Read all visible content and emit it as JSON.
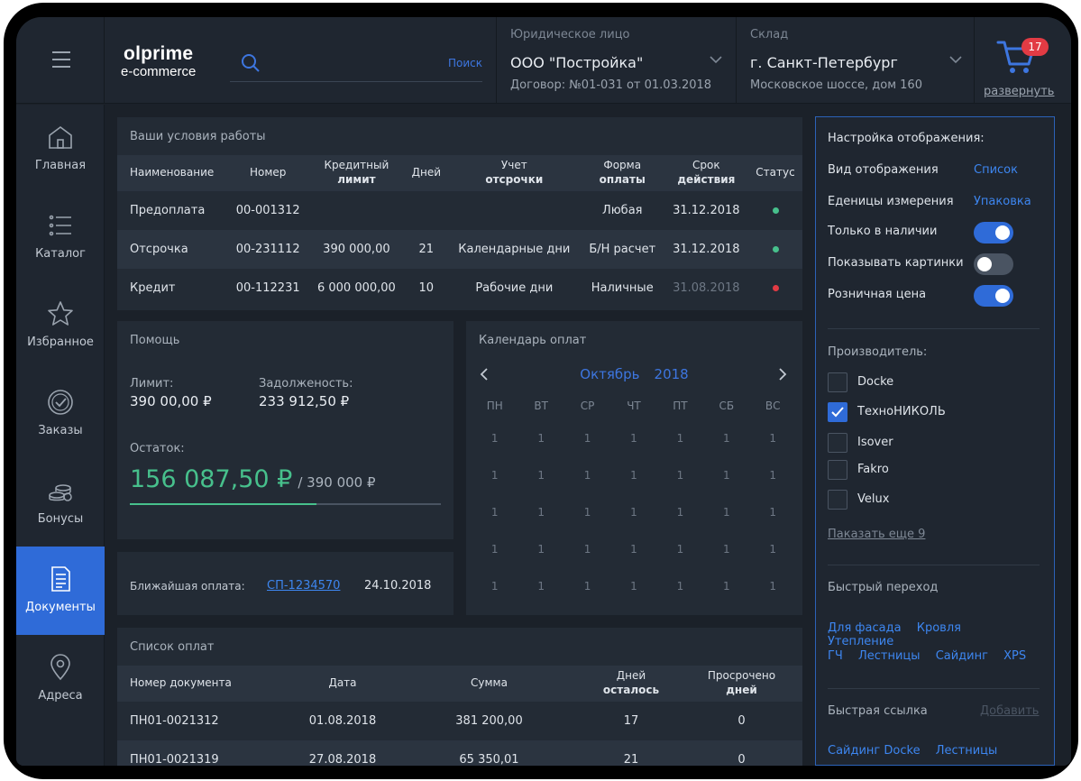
{
  "header": {
    "logo_main": "olprime",
    "logo_sub": "e-commerce",
    "search": {
      "placeholder": "",
      "button": "Поиск"
    },
    "legal": {
      "label": "Юридическое лицо",
      "value": "ООО \"Постройка\"",
      "sub": "Договор: №01-031 от 01.03.2018"
    },
    "store": {
      "label": "Склад",
      "value": "г. Санкт-Петербург",
      "sub": "Московское шоссе, дом 160"
    },
    "cart": {
      "count": "17",
      "expand": "развернуть"
    }
  },
  "sidebar": {
    "items": [
      {
        "label": "Главная",
        "icon": "home-icon"
      },
      {
        "label": "Каталог",
        "icon": "catalog-icon"
      },
      {
        "label": "Избранное",
        "icon": "star-icon"
      },
      {
        "label": "Заказы",
        "icon": "check-circle-icon"
      },
      {
        "label": "Бонусы",
        "icon": "coins-icon"
      },
      {
        "label": "Документы",
        "icon": "document-icon",
        "active": true
      },
      {
        "label": "Адреса",
        "icon": "location-pin-icon"
      }
    ]
  },
  "terms": {
    "title": "Ваши условия работы",
    "columns": {
      "name": "Наименование",
      "number": "Номер",
      "credit_1": "Кредитный",
      "credit_2": "лимит",
      "days": "Дней",
      "defer_1": "Учет",
      "defer_2": "отсрочки",
      "pay_1": "Форма",
      "pay_2": "оплаты",
      "term_1": "Срок",
      "term_2": "действия",
      "status": "Статус"
    },
    "rows": [
      {
        "name": "Предоплата",
        "number": "00-001312",
        "limit": "",
        "days": "",
        "defer": "",
        "payment": "Любая",
        "valid": "31.12.2018",
        "status_color": "#47c08c"
      },
      {
        "name": "Отсрочка",
        "number": "00-231112",
        "limit": "390 000,00",
        "days": "21",
        "defer": "Календарные дни",
        "payment": "Б/Н расчет",
        "valid": "31.12.2018",
        "status_color": "#47c08c"
      },
      {
        "name": "Кредит",
        "number": "00-112231",
        "limit": "6 000 000,00",
        "days": "10",
        "defer": "Рабочие дни",
        "payment": "Наличные",
        "valid": "31.08.2018",
        "status_color": "#e23b44"
      }
    ]
  },
  "help": {
    "title": "Помощь",
    "limit_label": "Лимит:",
    "limit_value": "390 00,00 ₽",
    "debt_label": "Задолженость:",
    "debt_value": "233 912,50 ₽",
    "rest_label": "Остаток:",
    "rest_value": "156 087,50 ₽",
    "rest_of": "/ 390 000 ₽",
    "rest_fraction": 0.6
  },
  "next_payment": {
    "label": "Ближайшая оплата:",
    "doc": "СП-1234570",
    "date": "24.10.2018"
  },
  "calendar": {
    "title": "Календарь оплат",
    "month": "Октябрь",
    "year": "2018",
    "weekdays": [
      "ПН",
      "ВТ",
      "СР",
      "ЧТ",
      "ПТ",
      "СБ",
      "ВС"
    ],
    "weeks": [
      [
        "1",
        "1",
        "1",
        "1",
        "1",
        "1",
        "1"
      ],
      [
        "1",
        "1",
        "1",
        "1",
        "1",
        "1",
        "1"
      ],
      [
        "1",
        "1",
        "1",
        "1",
        "1",
        "1",
        "1"
      ],
      [
        "1",
        "1",
        "1",
        "1",
        "1",
        "1",
        "1"
      ],
      [
        "1",
        "1",
        "1",
        "1",
        "1",
        "1",
        "1"
      ]
    ]
  },
  "payments": {
    "title": "Список оплат",
    "columns": {
      "doc": "Номер документа",
      "date": "Дата",
      "sum": "Сумма",
      "left_1": "Дней",
      "left_2": "осталось",
      "over_1": "Просрочено",
      "over_2": "дней"
    },
    "rows": [
      {
        "doc": "ПН01-0021312",
        "date": "01.08.2018",
        "sum": "381 200,00",
        "left": "17",
        "over": "0"
      },
      {
        "doc": "ПН01-0021319",
        "date": "27.08.2018",
        "sum": "65 350,01",
        "left": "21",
        "over": "0"
      }
    ]
  },
  "settings": {
    "title": "Настройка отображения:",
    "view_label": "Вид отображения",
    "view_value": "Список",
    "units_label": "Еденицы измерения",
    "units_value": "Упаковка",
    "toggles": [
      {
        "label": "Только в наличии",
        "on": true
      },
      {
        "label": "Показывать картинки",
        "on": false
      },
      {
        "label": "Розничная цена",
        "on": true
      }
    ],
    "maker_title": "Производитель:",
    "makers": [
      {
        "label": "Docke",
        "checked": false
      },
      {
        "label": "ТехноНИКОЛЬ",
        "checked": true
      },
      {
        "label": "Isover",
        "checked": false
      },
      {
        "label": "Fakro",
        "checked": false
      },
      {
        "label": "Velux",
        "checked": false
      }
    ],
    "show_more": "Паказать еще 9",
    "quick_title": "Быстрый переход",
    "quick_links_1": [
      "Для фасада",
      "Кровля",
      "Утепление"
    ],
    "quick_links_2": [
      "ГЧ",
      "Лестницы",
      "Сайдинг",
      "XPS"
    ],
    "fast_title": "Быстрая ссылка",
    "fast_add": "Добавить",
    "fast_links": [
      "Сайдинг Docke",
      "Лестницы"
    ]
  }
}
